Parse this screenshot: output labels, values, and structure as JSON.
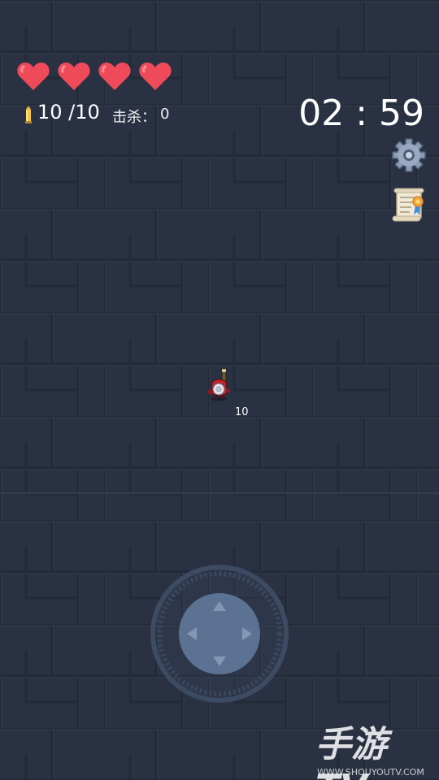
{
  "hud": {
    "hearts": 4,
    "ammo": "10 /10",
    "kills_label": "击杀：",
    "kills_value": "0",
    "timer": "02 : 59"
  },
  "player": {
    "ammo_label": "10"
  },
  "icons": {
    "settings": "gear-icon",
    "quests": "scroll-certificate-icon",
    "joystick": "dpad-joystick-icon",
    "heart": "heart-icon",
    "bullet": "bullet-icon"
  },
  "watermark": {
    "brand": "手游TV",
    "url": "WWW.SHOUYOUTV.COM"
  },
  "colors": {
    "floor": "#2a3142",
    "heart": "#ee4a5a",
    "joystick_ring": "#3c4a62",
    "joystick_pad": "#5c7292"
  }
}
